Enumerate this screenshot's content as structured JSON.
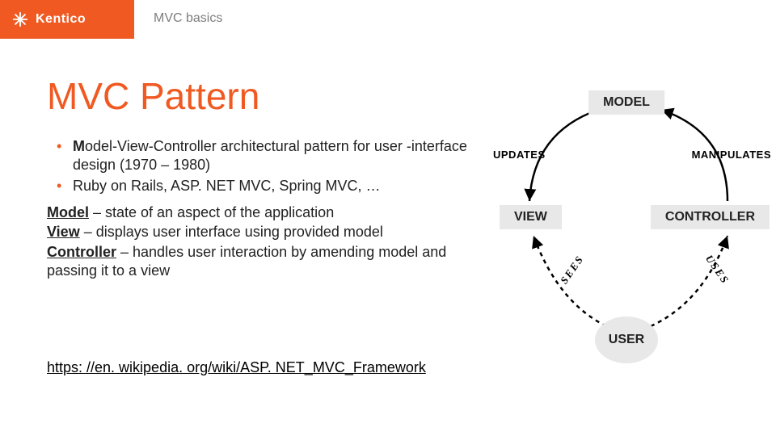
{
  "brand": "Kentico",
  "breadcrumb": "MVC basics",
  "title": "MVC Pattern",
  "bullets": [
    {
      "strong": "M",
      "rest": "odel-View-Controller architectural pattern for user -interface design (1970 – 1980)"
    },
    {
      "strong": "",
      "rest": "Ruby on Rails, ASP. NET MVC, Spring MVC, …"
    }
  ],
  "defs": {
    "model": {
      "term": "Model",
      "text": " – state of an aspect of the application"
    },
    "view": {
      "term": "View",
      "text": " – displays user interface using provided model"
    },
    "controller": {
      "term": "Controller",
      "text": " – handles user interaction by amending model and passing it to a view"
    }
  },
  "link": "https: //en. wikipedia. org/wiki/ASP. NET_MVC_Framework",
  "diagram": {
    "model": "MODEL",
    "view": "VIEW",
    "controller": "CONTROLLER",
    "user": "USER",
    "updates": "UPDATES",
    "manipulates": "MANIPULATES",
    "sees": "SEES",
    "uses": "USES"
  }
}
